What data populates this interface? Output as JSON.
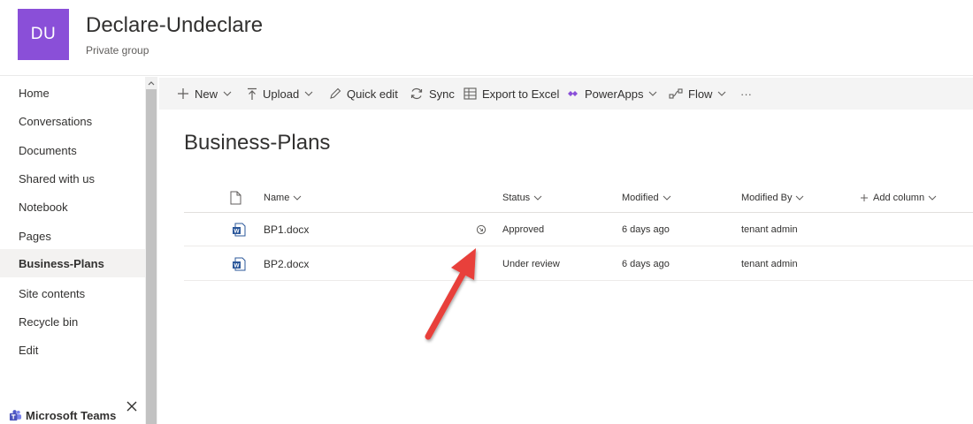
{
  "site": {
    "logo_initials": "DU",
    "title": "Declare-Undeclare",
    "subtitle": "Private group",
    "logo_color": "#8a4fd8"
  },
  "nav": {
    "items": [
      {
        "label": "Home"
      },
      {
        "label": "Conversations"
      },
      {
        "label": "Documents"
      },
      {
        "label": "Shared with us"
      },
      {
        "label": "Notebook"
      },
      {
        "label": "Pages"
      },
      {
        "label": "Business-Plans"
      },
      {
        "label": "Site contents"
      },
      {
        "label": "Recycle bin"
      },
      {
        "label": "Edit"
      }
    ],
    "active": "Business-Plans",
    "teams_label": "Microsoft Teams"
  },
  "command_bar": {
    "new": "New",
    "upload": "Upload",
    "quick_edit": "Quick edit",
    "sync": "Sync",
    "export": "Export to Excel",
    "powerapps": "PowerApps",
    "flow": "Flow",
    "more": "···"
  },
  "page": {
    "title": "Business-Plans"
  },
  "list": {
    "columns": {
      "name": "Name",
      "status": "Status",
      "modified": "Modified",
      "modified_by": "Modified By",
      "add_column": "Add column"
    },
    "rows": [
      {
        "name": "BP1.docx",
        "status": "Approved",
        "modified": "6 days ago",
        "modified_by": "tenant admin"
      },
      {
        "name": "BP2.docx",
        "status": "Under review",
        "modified": "6 days ago",
        "modified_by": "tenant admin"
      }
    ]
  },
  "colors": {
    "accent": "#8a4fd8",
    "annotation_arrow": "#e8413a",
    "word_blue": "#2b579a"
  }
}
